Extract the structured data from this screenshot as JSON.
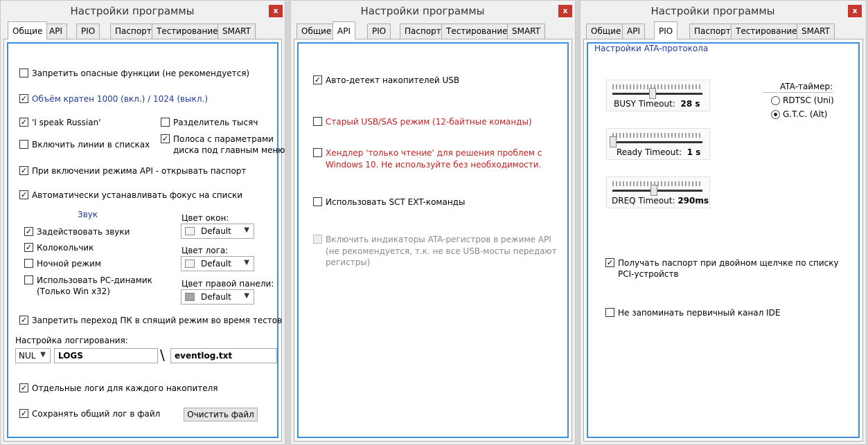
{
  "window_title": "Настройки программы",
  "close_glyph": "x",
  "tabs": [
    "Общие",
    "API",
    "PIO",
    "Паспорт",
    "Тестирование",
    "SMART"
  ],
  "general": {
    "disable_dangerous": "Запретить опасные функции (не рекомендуется)",
    "volume_1000": "Объём кратен 1000 (вкл.) / 1024 (выкл.)",
    "speak_russian": "'I speak Russian'",
    "thousand_sep": "Разделитель тысяч",
    "list_lines": "Включить линии в списках",
    "stripe_line1": "Полоса с параметрами",
    "stripe_line2": "диска под главным меню",
    "api_open_passport": "При включении режима API - открывать паспорт",
    "auto_focus": "Автоматически устанавливать фокус на списки",
    "sound_header": "Звук",
    "enable_sounds": "Задействовать звуки",
    "bell": "Колокольчик",
    "night_mode": "Ночной режим",
    "pc_speaker_line1": "Использовать PC-динамик",
    "pc_speaker_line2": "(Только Win x32)",
    "window_color_label": "Цвет окон:",
    "window_color_value": "Default",
    "log_color_label": "Цвет лога:",
    "log_color_value": "Default",
    "right_panel_color_label": "Цвет правой панели:",
    "right_panel_color_value": "Default",
    "no_sleep": "Запретить переход ПК в спящий режим во время тестов",
    "logging_label": "Настройка логгирования:",
    "log_level": "NUL",
    "log_folder": "LOGS",
    "path_sep": "\\",
    "log_file": "eventlog.txt",
    "separate_logs": "Отдельные логи для каждого накопителя",
    "save_common_log": "Сохранять общий лог в файл",
    "clear_file_button": "Очистить файл"
  },
  "api": {
    "usb_autodetect": "Авто-детект накопителей USB",
    "old_usb_sas_mode": "Старый USB/SAS режим (12-байтные команды)",
    "readonly_handler_line1": "Хендлер 'только чтение' для решения проблем с",
    "readonly_handler_line2": "Windows 10. Не используйте без необходимости.",
    "sct_ext": "Использовать SCT EXT-команды",
    "ata_indicators_line1": "Включить индикаторы ATA-регистров в режиме API",
    "ata_indicators_line2": "(не рекомендуется, т.к. не все USB-мосты передают",
    "ata_indicators_line3": "регистры)"
  },
  "pio": {
    "ata_settings_header": "Настройки ATA-протокола",
    "busy_timeout_label": "BUSY Timeout:",
    "busy_timeout_value": "28 s",
    "busy_level": 0.45,
    "ready_timeout_label": "Ready Timeout:",
    "ready_timeout_value": "1 s",
    "ready_level": 0.0,
    "dreq_timeout_label": "DREQ Timeout:",
    "dreq_timeout_value": "290ms",
    "dreq_level": 0.47,
    "ata_timer_header": "ATA-таймер:",
    "rdtsc": "RDTSC (Uni)",
    "gtc": "G.T.C. (Alt)",
    "passport_double_click_line1": "Получать паспорт при двойном щелчке по списку",
    "passport_double_click_line2": "PCI-устройств",
    "no_remember_ide": "Не запоминать первичный канал IDE"
  },
  "colors": {
    "accent_blue": "#3a8fde",
    "red_text": "#c41f1f",
    "blue_text": "#1e3a99",
    "close_red": "#c7352f"
  }
}
